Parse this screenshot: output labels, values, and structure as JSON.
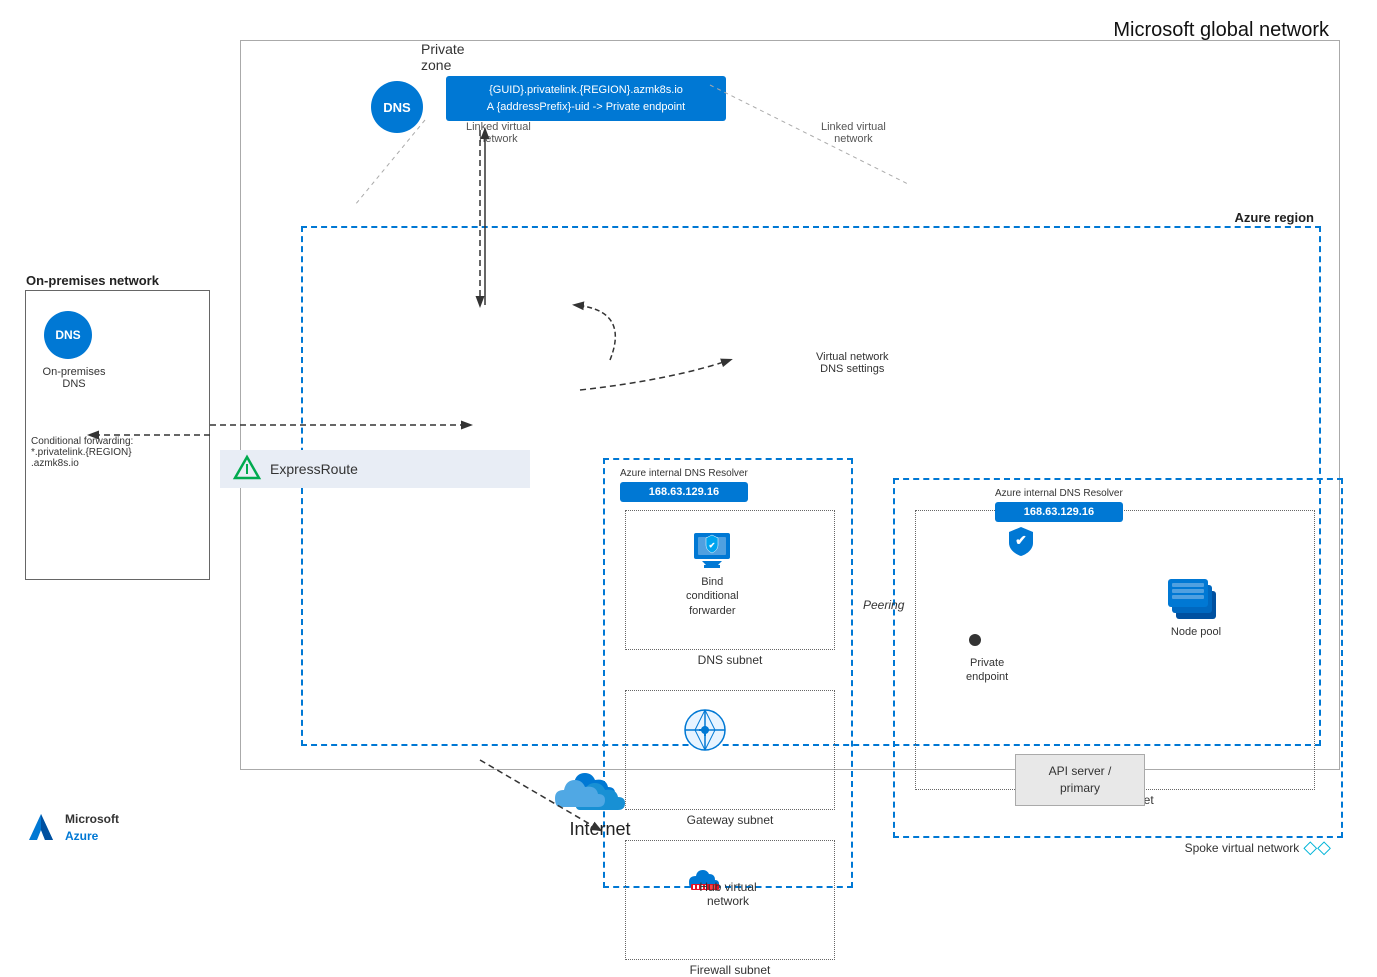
{
  "title": "Microsoft global network",
  "private_zone": {
    "label": "Private zone",
    "dns_record_line1": "{GUID}.privatelink.{REGION}.azmk8s.io",
    "dns_record_line2": "A {addressPrefix}-uid -> Private endpoint",
    "dns_label": "DNS"
  },
  "azure_region": {
    "label": "Azure region"
  },
  "on_premises": {
    "label": "On-premises network",
    "dns_label": "DNS",
    "node_label": "On-premises\nDNS",
    "conditional_forwarding": "Conditional forwarding:\n*.privatelink.{REGION}\n.azmk8s.io"
  },
  "hub_vnet": {
    "label": "Hub virtual\nnetwork",
    "dns_resolver_label": "Azure internal DNS Resolver",
    "dns_ip": "168.63.129.16",
    "bind_label": "Bind\nconditional\nforwarder",
    "dns_subnet_label": "DNS subnet",
    "gateway_subnet_label": "Gateway subnet",
    "firewall_subnet_label": "Firewall subnet"
  },
  "spoke_vnet": {
    "label": "Spoke virtual network",
    "dns_resolver_label": "Azure internal DNS Resolver",
    "dns_ip": "168.63.129.16",
    "cluster_subnet_label": "Cluster subnet",
    "private_endpoint_label": "Private\nendpoint",
    "node_pool_label": "Node pool"
  },
  "other": {
    "expressroute_label": "ExpressRoute",
    "peering_label": "Peering",
    "vnet_dns_settings": "Virtual network\nDNS settings",
    "linked_vnet_left": "Linked virtual\nnetwork",
    "linked_vnet_right": "Linked virtual\nnetwork",
    "api_server_label": "API server /\nprimary",
    "internet_label": "Internet"
  },
  "footer": {
    "company": "Microsoft",
    "product": "Azure"
  }
}
